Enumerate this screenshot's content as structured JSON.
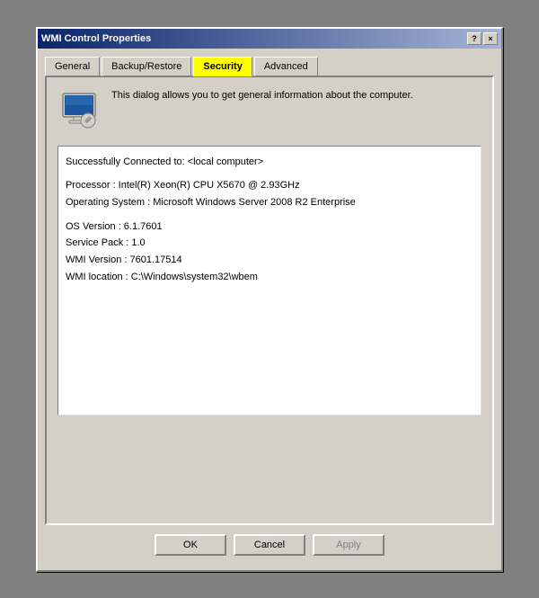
{
  "window": {
    "title": "WMI Control Properties",
    "title_btn_help": "?",
    "title_btn_close": "×"
  },
  "tabs": [
    {
      "id": "general",
      "label": "General",
      "active": false
    },
    {
      "id": "backup",
      "label": "Backup/Restore",
      "active": false
    },
    {
      "id": "security",
      "label": "Security",
      "active": true
    },
    {
      "id": "advanced",
      "label": "Advanced",
      "active": false
    }
  ],
  "info_text": "This dialog allows you to get general information about the computer.",
  "details": {
    "line1": "Successfully Connected to: <local computer>",
    "line2": "Processor :  Intel(R) Xeon(R) CPU        X5670  @ 2.93GHz",
    "line3": "Operating System :  Microsoft Windows Server 2008 R2 Enterprise",
    "line4": "OS Version :  6.1.7601",
    "line5": "Service Pack :  1.0",
    "line6": "WMI Version :  7601.17514",
    "line7": "WMI location :  C:\\Windows\\system32\\wbem"
  },
  "buttons": {
    "ok": "OK",
    "cancel": "Cancel",
    "apply": "Apply"
  }
}
